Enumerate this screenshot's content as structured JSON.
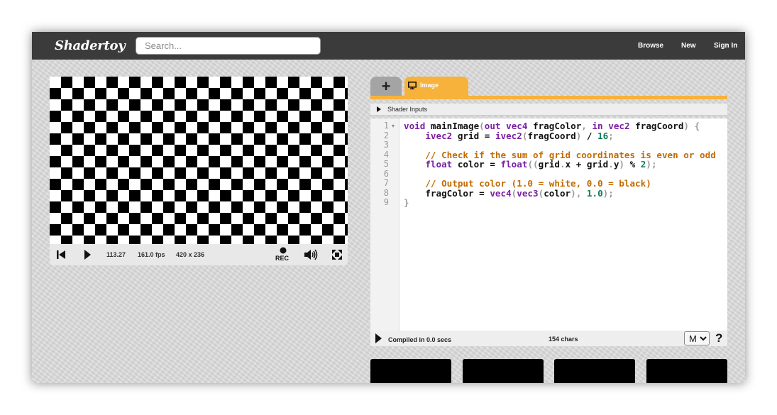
{
  "topbar": {
    "logo": "Shadertoy",
    "search_placeholder": "Search...",
    "nav": {
      "browse": "Browse",
      "new": "New",
      "sign_in": "Sign In"
    }
  },
  "viewer": {
    "pattern": "checkerboard",
    "colors": {
      "dark": "#000000",
      "light": "#ffffff"
    },
    "controls": {
      "time": "113.27",
      "fps": "161.0 fps",
      "resolution": "420 x 236",
      "rec_label": "REC",
      "icons": [
        "rewind-icon",
        "play-icon",
        "record-icon",
        "volume-icon",
        "fullscreen-icon"
      ]
    }
  },
  "editor": {
    "add_tab_label": "+",
    "active_tab": "Image",
    "shader_inputs_label": "Shader Inputs",
    "line_numbers": [
      "1",
      "2",
      "3",
      "4",
      "5",
      "6",
      "7",
      "8",
      "9"
    ],
    "code_lines": [
      "void mainImage(out vec4 fragColor, in vec2 fragCoord) {",
      "    ivec2 grid = ivec2(fragCoord) / 16;",
      "",
      "    // Check if the sum of grid coordinates is even or odd",
      "    float color = float((grid.x + grid.y) % 2);",
      "",
      "    // Output color (1.0 = white, 0.0 = black)",
      "    fragColor = vec4(vec3(color), 1.0);",
      "}"
    ],
    "status": {
      "compiled": "Compiled in 0.0 secs",
      "chars": "154 chars",
      "mode_selected": "M",
      "help": "?"
    },
    "accent_color": "#f7b23b"
  }
}
